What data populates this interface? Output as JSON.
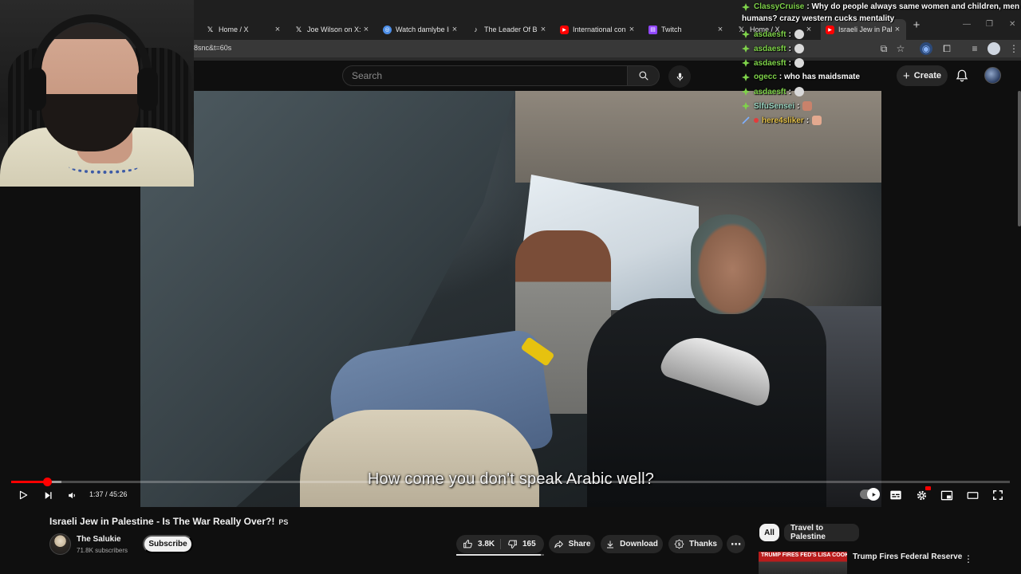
{
  "browser": {
    "tabs": [
      {
        "label": "Home / X",
        "icon": "x-logo-icon"
      },
      {
        "label": "Joe Wilson on X:",
        "icon": "x-logo-icon"
      },
      {
        "label": "Watch damlybe live",
        "icon": "globe-icon"
      },
      {
        "label": "The Leader Of Big",
        "icon": "tiktok-icon"
      },
      {
        "label": "International cons",
        "icon": "youtube-icon"
      },
      {
        "label": "Twitch",
        "icon": "twitch-icon"
      },
      {
        "label": "Home / X",
        "icon": "x-logo-icon"
      },
      {
        "label": "Israeli Jew in Pale",
        "icon": "youtube-icon"
      }
    ],
    "address_fragment": "8snc&t=60s",
    "new_tab_symbol": "+"
  },
  "youtube": {
    "search_placeholder": "Search",
    "create_label": "Create",
    "subtitle": "How come you don't speak Arabic well?",
    "player": {
      "current_time": "1:37",
      "duration": "45:26",
      "time_display": "1:37 / 45:26",
      "played_fraction": 0.036,
      "buffered_fraction": 0.05,
      "autoplay_on": true
    },
    "video": {
      "title": "Israeli Jew in Palestine - Is The War Really Over?!",
      "title_badge": "PS",
      "channel": "The Salukie",
      "subscribers": "71.8K subscribers",
      "subscribe_label": "Subscribe",
      "likes": "3.8K",
      "dislikes": "165",
      "share_label": "Share",
      "download_label": "Download",
      "thanks_label": "Thanks",
      "like_ratio": 0.96
    },
    "chips": [
      "All",
      "Travel to Palestine"
    ],
    "recommendation": {
      "thumb_text": "TRUMP FIRES FED'S LISA COOK",
      "title": "Trump Fires Federal Reserve"
    }
  },
  "chat": {
    "messages": [
      {
        "user": "ClassyCruise",
        "text": ": Why do people always same women and children, men are",
        "color": "#7fd34a",
        "badge": "sub-diamond-icon"
      },
      {
        "user": "",
        "text": "humans? crazy western cucks mentality",
        "color": "#ffffff",
        "badge": ""
      },
      {
        "user": "asdaesft",
        "text": ":",
        "color": "#7fd34a",
        "badge": "sub-diamond-icon",
        "emote": "skull-emote"
      },
      {
        "user": "asdaesft",
        "text": ":",
        "color": "#7fd34a",
        "badge": "sub-diamond-icon",
        "emote": "skull-emote"
      },
      {
        "user": "asdaesft",
        "text": ":",
        "color": "#7fd34a",
        "badge": "sub-diamond-icon",
        "emote": "skull-emote"
      },
      {
        "user": "ogecc",
        "text": ": who has maidsmate",
        "color": "#7fd34a",
        "badge": "sub-diamond-icon"
      },
      {
        "user": "asdaesft",
        "text": ":",
        "color": "#7fd34a",
        "badge": "sub-diamond-icon",
        "emote": "skull-emote"
      },
      {
        "user": "SlfuSensei",
        "text": ":",
        "color": "#9bd6c2",
        "badge": "sub-diamond-icon",
        "emote": "face-emote"
      },
      {
        "user": "here4sliker",
        "text": ":",
        "color": "#e5c24a",
        "badge": "sword-badge-icon",
        "emote": "face-emote"
      }
    ]
  },
  "colors": {
    "accent": "#ff0000",
    "chat_green": "#7fd34a",
    "page_bg": "#0f0f0f"
  }
}
